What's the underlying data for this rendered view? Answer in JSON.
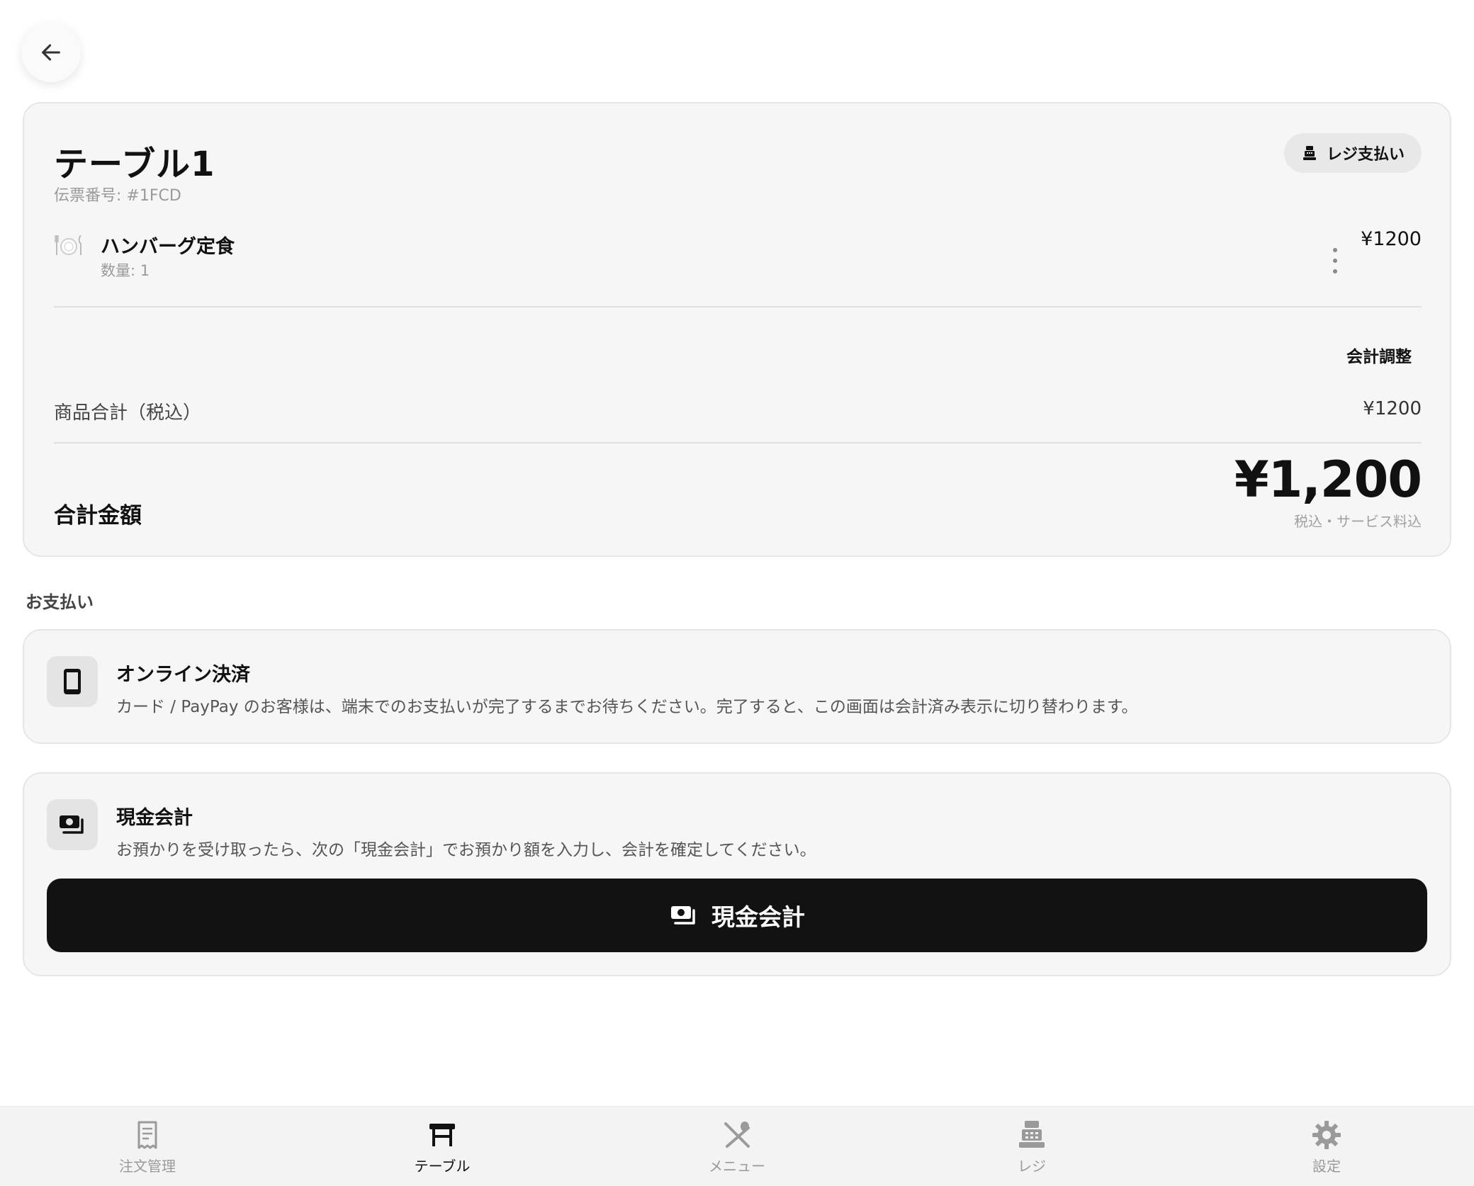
{
  "header": {
    "back_icon": "arrow-left-icon"
  },
  "bill": {
    "table_title": "テーブル1",
    "slip_number": "伝票番号: #1FCD",
    "register_pay_label": "レジ支払い",
    "items": [
      {
        "icon": "dish-icon",
        "name": "ハンバーグ定食",
        "quantity": "数量: 1",
        "price": "¥1200"
      }
    ],
    "adjust_label": "会計調整",
    "subtotal_label": "商品合計（税込）",
    "subtotal_value": "¥1200",
    "total_label": "合計金額",
    "total_value": "¥1,200",
    "total_note": "税込・サービス料込"
  },
  "payment": {
    "heading": "お支払い",
    "online": {
      "icon": "smartphone-icon",
      "title": "オンライン決済",
      "description": "カード / PayPay のお客様は、端末でのお支払いが完了するまでお待ちください。完了すると、この画面は会計済み表示に切り替わります。"
    },
    "cash": {
      "icon": "cash-icon",
      "title": "現金会計",
      "description": "お預かりを受け取ったら、次の「現金会計」でお預かり額を入力し、会計を確定してください。",
      "button_label": "現金会計"
    }
  },
  "nav": {
    "items": [
      {
        "label": "注文管理",
        "icon": "receipt-icon",
        "active": false
      },
      {
        "label": "テーブル",
        "icon": "table-icon",
        "active": true
      },
      {
        "label": "メニュー",
        "icon": "utensils-icon",
        "active": false
      },
      {
        "label": "レジ",
        "icon": "register-icon",
        "active": false
      },
      {
        "label": "設定",
        "icon": "gear-icon",
        "active": false
      }
    ]
  },
  "colors": {
    "primary": "#121212",
    "card_bg": "#f6f6f6",
    "muted_text": "#9a9a9a"
  }
}
